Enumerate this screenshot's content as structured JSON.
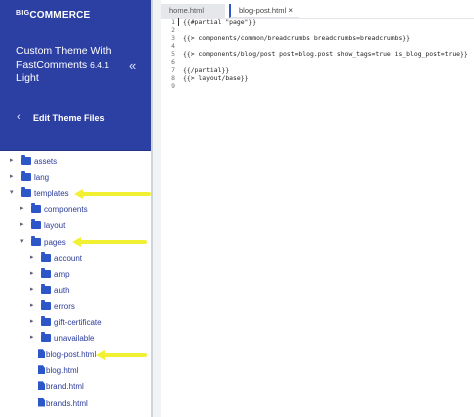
{
  "sidebar": {
    "logo_small": "BIG",
    "logo_main": "COMMERCE",
    "theme_title": "Custom Theme With FastComments",
    "theme_version": "6.4.1",
    "theme_variant": "Light",
    "collapse_glyph": "«",
    "back_label": "Edit Theme Files",
    "tree": [
      {
        "label": "assets",
        "type": "folder",
        "expanded": false
      },
      {
        "label": "lang",
        "type": "folder",
        "expanded": false
      },
      {
        "label": "templates",
        "type": "folder",
        "expanded": true
      },
      {
        "label": "components",
        "type": "folder",
        "expanded": false
      },
      {
        "label": "layout",
        "type": "folder",
        "expanded": false
      },
      {
        "label": "pages",
        "type": "folder",
        "expanded": true
      },
      {
        "label": "account",
        "type": "folder",
        "expanded": false
      },
      {
        "label": "amp",
        "type": "folder",
        "expanded": false
      },
      {
        "label": "auth",
        "type": "folder",
        "expanded": false
      },
      {
        "label": "errors",
        "type": "folder",
        "expanded": false
      },
      {
        "label": "gift-certificate",
        "type": "folder",
        "expanded": false
      },
      {
        "label": "unavailable",
        "type": "folder",
        "expanded": false
      },
      {
        "label": "blog-post.html",
        "type": "file"
      },
      {
        "label": "blog.html",
        "type": "file"
      },
      {
        "label": "brand.html",
        "type": "file"
      },
      {
        "label": "brands.html",
        "type": "file"
      }
    ]
  },
  "editor": {
    "tabs": [
      {
        "label": "home.html",
        "active": false
      },
      {
        "label": "blog-post.html",
        "active": true
      }
    ],
    "close_glyph": "×",
    "lines": [
      {
        "n": "1",
        "text": "{{#partial \"page\"}}"
      },
      {
        "n": "2",
        "text": ""
      },
      {
        "n": "3",
        "text": "{{> components/common/breadcrumbs breadcrumbs=breadcrumbs}}"
      },
      {
        "n": "4",
        "text": ""
      },
      {
        "n": "5",
        "text": "{{> components/blog/post post=blog.post show_tags=true is_blog_post=true}}"
      },
      {
        "n": "6",
        "text": ""
      },
      {
        "n": "7",
        "text": "{{/partial}}"
      },
      {
        "n": "8",
        "text": "{{> layout/base}}"
      },
      {
        "n": "9",
        "text": ""
      }
    ]
  },
  "colors": {
    "header_bg": "#2c3fa3",
    "folder_icon": "#2d57c9",
    "tree_text": "#2b3b9a",
    "annotation_arrow": "#f2f032"
  }
}
